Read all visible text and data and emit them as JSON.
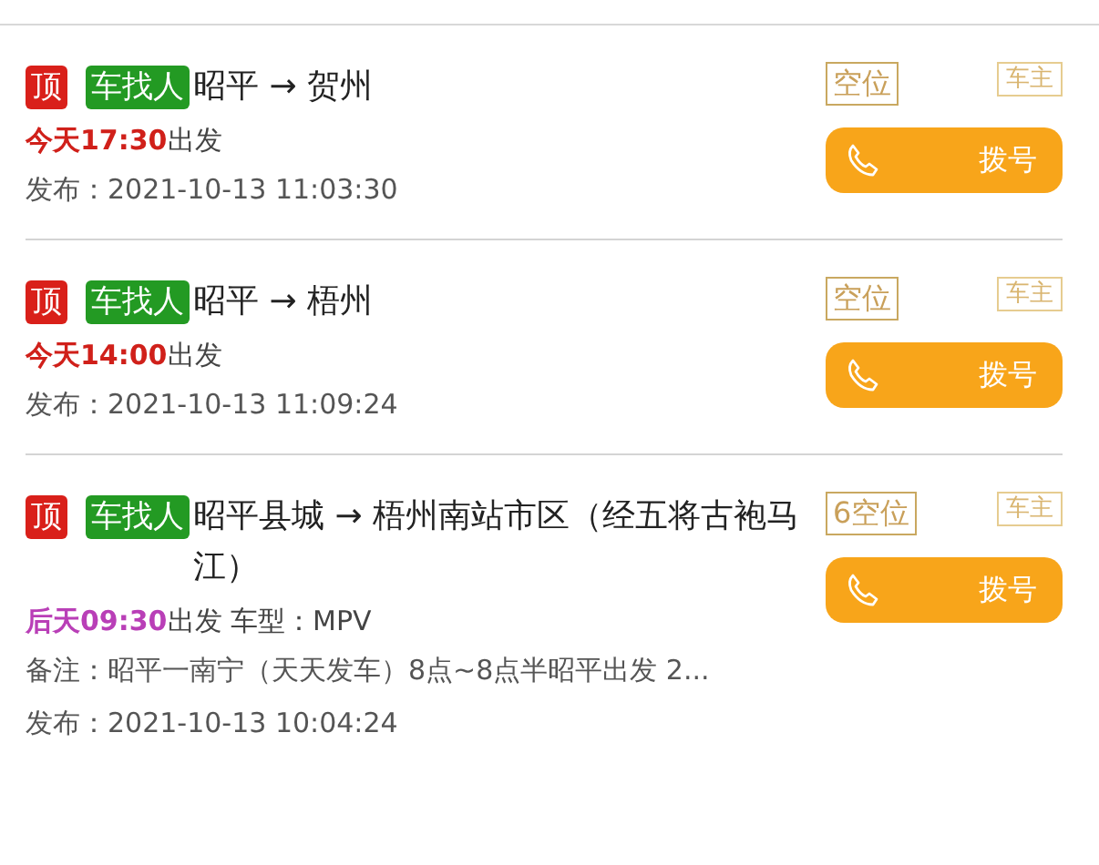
{
  "trips": [
    {
      "top_tag": "顶",
      "type_tag": "车找人",
      "route": "昭平 → 贺州",
      "seats": "空位",
      "role": "车主",
      "time": {
        "text": "今天17:30",
        "color": "#d0201a"
      },
      "depart": "出发",
      "lines": [
        "发布：2021-10-13 11:03:30"
      ],
      "dial": "拨号"
    },
    {
      "top_tag": "顶",
      "type_tag": "车找人",
      "route": "昭平 → 梧州",
      "seats": "空位",
      "role": "车主",
      "time": {
        "text": "今天14:00",
        "color": "#d0201a"
      },
      "depart": "出发",
      "lines": [
        "发布：2021-10-13 11:09:24"
      ],
      "dial": "拨号"
    },
    {
      "top_tag": "顶",
      "type_tag": "车找人",
      "route": "昭平县城 → 梧州南站市区（经五将古袍马江）",
      "seats": "6空位",
      "role": "车主",
      "time": {
        "text": "后天09:30",
        "color": "#b93fb7"
      },
      "depart": "出发 车型：MPV",
      "lines": [
        "备注：昭平一南宁（天天发车）8点~8点半昭平出发 2...",
        "发布：2021-10-13 10:04:24"
      ],
      "dial": "拨号"
    }
  ]
}
